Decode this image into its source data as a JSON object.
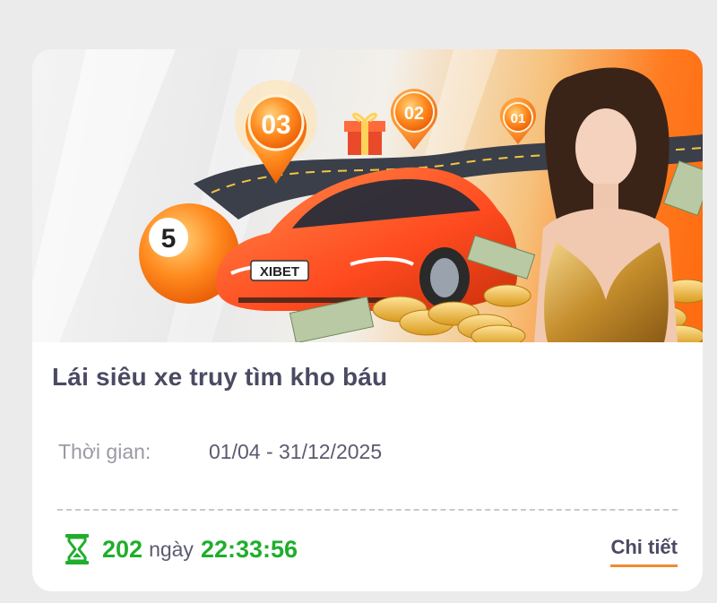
{
  "promo": {
    "title": "Lái siêu xe truy tìm kho báu",
    "period_label": "Thời gian:",
    "period_value": "01/04 - 31/12/2025",
    "countdown": {
      "days": "202",
      "days_unit": "ngày",
      "time": "22:33:56"
    },
    "details_label": "Chi tiết"
  },
  "banner": {
    "markers": [
      "03",
      "02",
      "01"
    ],
    "ball_number": "5",
    "plate_text": "XIBET"
  },
  "colors": {
    "countdown_green": "#1fae2c",
    "accent_orange": "#f28b2c",
    "title_text": "#4a4a63"
  },
  "icons": {
    "countdown": "hourglass-icon"
  }
}
